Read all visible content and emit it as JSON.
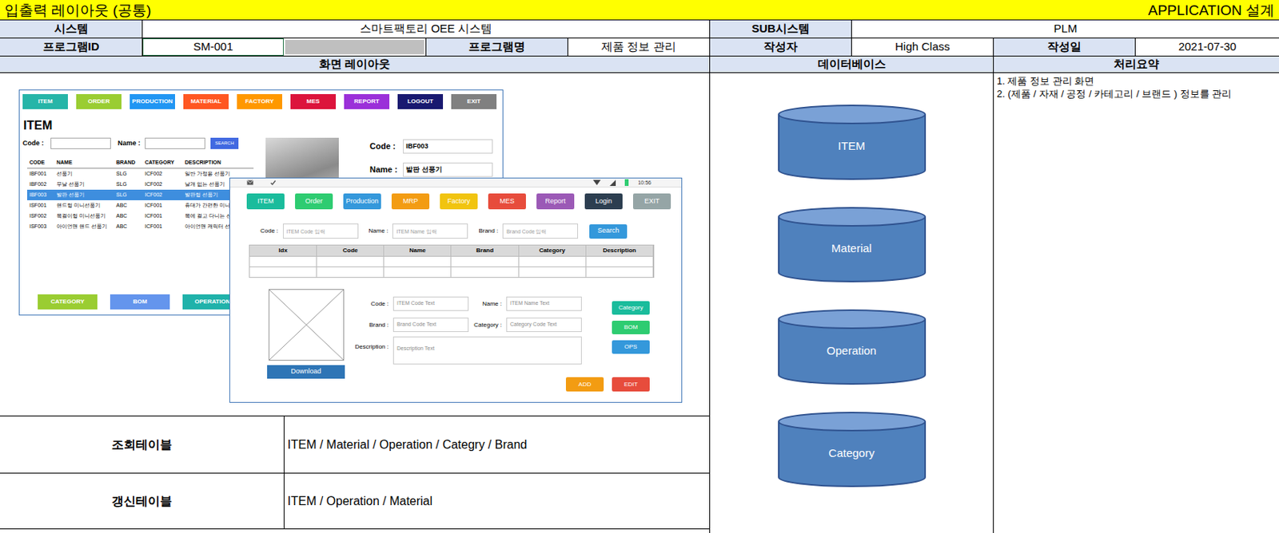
{
  "header": {
    "title": "입출력 레이아웃 (공통)",
    "right": "APPLICATION 설계"
  },
  "info": {
    "system_label": "시스템",
    "system": "스마트팩토리 OEE 시스템",
    "sub_system_label": "SUB시스템",
    "sub_system": "PLM",
    "program_id_label": "프로그램ID",
    "program_id": "SM-001",
    "program_name_label": "프로그램명",
    "program_name": "제품 정보 관리",
    "author_label": "작성자",
    "author": "High Class",
    "date_label": "작성일",
    "date": "2021-07-30"
  },
  "sections": {
    "layout": "화면 레이아웃",
    "database": "데이터베이스",
    "summary": "처리요약"
  },
  "summary_lines": [
    "1. 제품 정보 관리 화면",
    "2. (제품 / 자재 / 공정 / 카테고리 / 브랜드 ) 정보를 관리"
  ],
  "databases": [
    "ITEM",
    "Material",
    "Operation",
    "Category"
  ],
  "tables": [
    {
      "label": "조회테이블",
      "value": "ITEM / Material / Operation / Categry / Brand"
    },
    {
      "label": "갱신테이블",
      "value": "ITEM / Operation / Material"
    }
  ],
  "old_mockup": {
    "nav": [
      {
        "label": "ITEM",
        "color": "#26b5a8"
      },
      {
        "label": "ORDER",
        "color": "#9acd32"
      },
      {
        "label": "PRODUCTION",
        "color": "#2196f3"
      },
      {
        "label": "MATERIAL",
        "color": "#ff5722"
      },
      {
        "label": "FACTORY",
        "color": "#ff9800"
      },
      {
        "label": "MES",
        "color": "#dc143c"
      },
      {
        "label": "REPORT",
        "color": "#9b30d9"
      },
      {
        "label": "LOGOUT",
        "color": "#191970"
      },
      {
        "label": "EXIT",
        "color": "#808080"
      }
    ],
    "title": "ITEM",
    "search": {
      "code_label": "Code :",
      "name_label": "Name :",
      "button": "SEARCH"
    },
    "table": {
      "columns": [
        "CODE",
        "NAME",
        "BRAND",
        "CATEGORY",
        "DESCRIPTION"
      ],
      "rows": [
        {
          "cells": [
            "IBF001",
            "선풍기",
            "SLG",
            "ICF002",
            "일반 가정용 선풍기"
          ],
          "selected": false
        },
        {
          "cells": [
            "IBF002",
            "무날 선풍기",
            "SLG",
            "ICF002",
            "날개 없는 선풍기"
          ],
          "selected": false
        },
        {
          "cells": [
            "IBF003",
            "발판 선풍기",
            "SLG",
            "ICF002",
            "발판형 선풍기"
          ],
          "selected": true
        },
        {
          "cells": [
            "ISF001",
            "핸드형 미니선풍기",
            "ABC",
            "ICF001",
            "휴대가 간편한 미니 선"
          ],
          "selected": false
        },
        {
          "cells": [
            "ISF002",
            "목걸이형 미니선풍기",
            "ABC",
            "ICF001",
            "목에 걸고 다니는 선풍"
          ],
          "selected": false
        },
        {
          "cells": [
            "ISF003",
            "아이언맨 핸드 선풍기",
            "ABC",
            "ICF001",
            "아이언맨 캐릭터 선풍"
          ],
          "selected": false
        }
      ]
    },
    "detail": {
      "code_label": "Code :",
      "code_value": "IBF003",
      "name_label": "Name :",
      "name_value": "발판 선풍기"
    },
    "buttons": [
      {
        "label": "CATEGORY",
        "color": "#9acd32"
      },
      {
        "label": "BOM",
        "color": "#6495ed"
      },
      {
        "label": "OPERATION",
        "color": "#20b2aa"
      }
    ]
  },
  "new_mockup": {
    "status_time": "10:56",
    "nav": [
      {
        "label": "ITEM",
        "color": "#1abc9c"
      },
      {
        "label": "Order",
        "color": "#2ecc71"
      },
      {
        "label": "Production",
        "color": "#3498db"
      },
      {
        "label": "MRP",
        "color": "#f39c12"
      },
      {
        "label": "Factory",
        "color": "#f1c40f"
      },
      {
        "label": "MES",
        "color": "#e74c3c"
      },
      {
        "label": "Report",
        "color": "#9b59b6"
      },
      {
        "label": "Login",
        "color": "#2c3e50"
      },
      {
        "label": "EXIT",
        "color": "#95a5a6"
      }
    ],
    "search": {
      "fields": [
        {
          "label": "Code :",
          "placeholder": "ITEM Code 입력"
        },
        {
          "label": "Name :",
          "placeholder": "ITEM Name 입력"
        },
        {
          "label": "Brand :",
          "placeholder": "Brand Code 입력"
        }
      ],
      "button": "Search"
    },
    "table": {
      "columns": [
        "Idx",
        "Code",
        "Name",
        "Brand",
        "Category",
        "Description"
      ],
      "rows": [
        [
          "",
          "",
          "",
          "",
          "",
          ""
        ],
        [
          "",
          "",
          "",
          "",
          "",
          ""
        ]
      ]
    },
    "download": "Download",
    "fields": [
      {
        "label": "Code :",
        "value": "ITEM Code Text"
      },
      {
        "label": "Name :",
        "value": "ITEM Name Text"
      },
      {
        "label": "Brand :",
        "value": "Brand Code Text"
      },
      {
        "label": "Category :",
        "value": "Category Code Text"
      }
    ],
    "description": {
      "label": "Description :",
      "value": "Description Text"
    },
    "side_buttons": [
      {
        "label": "Category",
        "color": "#1abc9c"
      },
      {
        "label": "BOM",
        "color": "#2ecc71"
      },
      {
        "label": "OPS",
        "color": "#3498db"
      }
    ],
    "actions": [
      {
        "label": "ADD",
        "color": "#f39c12"
      },
      {
        "label": "EDIT",
        "color": "#e74c3c"
      }
    ]
  }
}
